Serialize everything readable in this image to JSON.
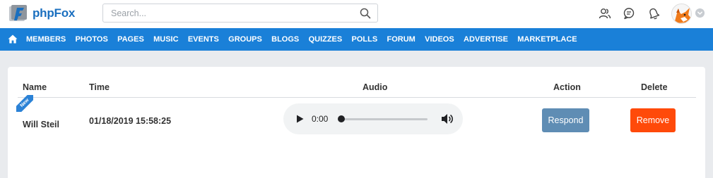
{
  "header": {
    "logo_text": "phpFox",
    "search_placeholder": "Search...",
    "icons": [
      "friends-icon",
      "chat-icon",
      "notifications-bell-icon"
    ],
    "avatar_caret_icon": "chevron-down-circle-icon"
  },
  "nav": {
    "home_icon": "home-icon",
    "items": [
      "MEMBERS",
      "PHOTOS",
      "PAGES",
      "MUSIC",
      "EVENTS",
      "GROUPS",
      "BLOGS",
      "QUIZZES",
      "POLLS",
      "FORUM",
      "VIDEOS",
      "ADVERTISE",
      "MARKETPLACE"
    ]
  },
  "table": {
    "columns": {
      "name": "Name",
      "time": "Time",
      "audio": "Audio",
      "action": "Action",
      "delete": "Delete"
    },
    "rows": [
      {
        "badge": "New",
        "name": "Will Steil",
        "time": "01/18/2019 15:58:25",
        "audio": {
          "current_time": "0:00",
          "progress_fraction": 0.0
        },
        "action_label": "Respond",
        "delete_label": "Remove"
      }
    ]
  },
  "colors": {
    "nav_bg": "#1a80d8",
    "respond_button": "#5f8db4",
    "remove_button": "#ff4a0a",
    "new_badge": "#2b82d6",
    "page_bg": "#e9ebee"
  }
}
